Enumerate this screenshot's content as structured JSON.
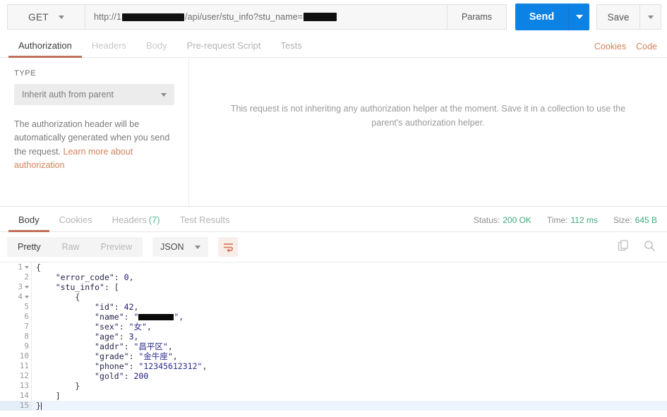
{
  "request": {
    "method": "GET",
    "url_prefix": "http://1",
    "url_middle": "/api/user/stu_info?stu_name=",
    "params_label": "Params",
    "send_label": "Send",
    "save_label": "Save"
  },
  "request_tabs": [
    {
      "label": "Authorization",
      "active": true
    },
    {
      "label": "Headers",
      "active": false
    },
    {
      "label": "Body",
      "active": false
    },
    {
      "label": "Pre-request Script",
      "active": false
    },
    {
      "label": "Tests",
      "active": false
    }
  ],
  "top_links": {
    "cookies": "Cookies",
    "code": "Code"
  },
  "authorization": {
    "type_label": "TYPE",
    "type_value": "Inherit auth from parent",
    "description_text": "The authorization header will be automatically generated when you send the request. ",
    "description_link": "Learn more about authorization",
    "center_message": "This request is not inheriting any authorization helper at the moment. Save it in a collection to use the parent's authorization helper."
  },
  "response_tabs": [
    {
      "label": "Body",
      "active": true,
      "count": ""
    },
    {
      "label": "Cookies",
      "active": false,
      "count": ""
    },
    {
      "label": "Headers",
      "active": false,
      "count": "(7)"
    },
    {
      "label": "Test Results",
      "active": false,
      "count": ""
    }
  ],
  "response_meta": {
    "status_label": "Status:",
    "status_value": "200 OK",
    "time_label": "Time:",
    "time_value": "112 ms",
    "size_label": "Size:",
    "size_value": "645 B"
  },
  "format_bar": {
    "modes": [
      {
        "label": "Pretty",
        "active": true
      },
      {
        "label": "Raw",
        "active": false
      },
      {
        "label": "Preview",
        "active": false
      }
    ],
    "language": "JSON",
    "wrap_icon": "word-wrap-icon",
    "copy_icon": "copy-icon",
    "search_icon": "search-icon"
  },
  "response_body": {
    "language": "json",
    "lines": [
      {
        "num": "1",
        "fold": true,
        "indent": 0,
        "segments": [
          {
            "t": "{",
            "c": "p"
          }
        ]
      },
      {
        "num": "2",
        "fold": false,
        "indent": 1,
        "segments": [
          {
            "t": "\"error_code\"",
            "c": "k"
          },
          {
            "t": ": ",
            "c": "p"
          },
          {
            "t": "0",
            "c": "n"
          },
          {
            "t": ",",
            "c": "p"
          }
        ]
      },
      {
        "num": "3",
        "fold": true,
        "indent": 1,
        "segments": [
          {
            "t": "\"stu_info\"",
            "c": "k"
          },
          {
            "t": ": [",
            "c": "p"
          }
        ]
      },
      {
        "num": "4",
        "fold": true,
        "indent": 2,
        "segments": [
          {
            "t": "{",
            "c": "p"
          }
        ]
      },
      {
        "num": "5",
        "fold": false,
        "indent": 3,
        "segments": [
          {
            "t": "\"id\"",
            "c": "k"
          },
          {
            "t": ": ",
            "c": "p"
          },
          {
            "t": "42",
            "c": "n"
          },
          {
            "t": ",",
            "c": "p"
          }
        ]
      },
      {
        "num": "6",
        "fold": false,
        "indent": 3,
        "redacted": true,
        "segments": [
          {
            "t": "\"name\"",
            "c": "k"
          },
          {
            "t": ": \"",
            "c": "s"
          }
        ]
      },
      {
        "num": "7",
        "fold": false,
        "indent": 3,
        "segments": [
          {
            "t": "\"sex\"",
            "c": "k"
          },
          {
            "t": ": ",
            "c": "p"
          },
          {
            "t": "\"女\"",
            "c": "s"
          },
          {
            "t": ",",
            "c": "p"
          }
        ]
      },
      {
        "num": "8",
        "fold": false,
        "indent": 3,
        "segments": [
          {
            "t": "\"age\"",
            "c": "k"
          },
          {
            "t": ": ",
            "c": "p"
          },
          {
            "t": "3",
            "c": "n"
          },
          {
            "t": ",",
            "c": "p"
          }
        ]
      },
      {
        "num": "9",
        "fold": false,
        "indent": 3,
        "segments": [
          {
            "t": "\"addr\"",
            "c": "k"
          },
          {
            "t": ": ",
            "c": "p"
          },
          {
            "t": "\"昌平区\"",
            "c": "s"
          },
          {
            "t": ",",
            "c": "p"
          }
        ]
      },
      {
        "num": "10",
        "fold": false,
        "indent": 3,
        "segments": [
          {
            "t": "\"grade\"",
            "c": "k"
          },
          {
            "t": ": ",
            "c": "p"
          },
          {
            "t": "\"金牛座\"",
            "c": "s"
          },
          {
            "t": ",",
            "c": "p"
          }
        ]
      },
      {
        "num": "11",
        "fold": false,
        "indent": 3,
        "segments": [
          {
            "t": "\"phone\"",
            "c": "k"
          },
          {
            "t": ": ",
            "c": "p"
          },
          {
            "t": "\"12345612312\"",
            "c": "s"
          },
          {
            "t": ",",
            "c": "p"
          }
        ]
      },
      {
        "num": "12",
        "fold": false,
        "indent": 3,
        "segments": [
          {
            "t": "\"gold\"",
            "c": "k"
          },
          {
            "t": ": ",
            "c": "p"
          },
          {
            "t": "200",
            "c": "n"
          }
        ]
      },
      {
        "num": "13",
        "fold": false,
        "indent": 2,
        "segments": [
          {
            "t": "}",
            "c": "p"
          }
        ]
      },
      {
        "num": "14",
        "fold": false,
        "indent": 1,
        "segments": [
          {
            "t": "]",
            "c": "p"
          }
        ]
      },
      {
        "num": "15",
        "fold": false,
        "indent": 0,
        "highlight": true,
        "cursor": true,
        "segments": [
          {
            "t": "}",
            "c": "p"
          }
        ]
      }
    ]
  },
  "colors": {
    "accent_orange": "#c0705a",
    "send_blue": "#0d82e5",
    "status_green": "#3fa87a",
    "link_orange": "#d4815c"
  }
}
